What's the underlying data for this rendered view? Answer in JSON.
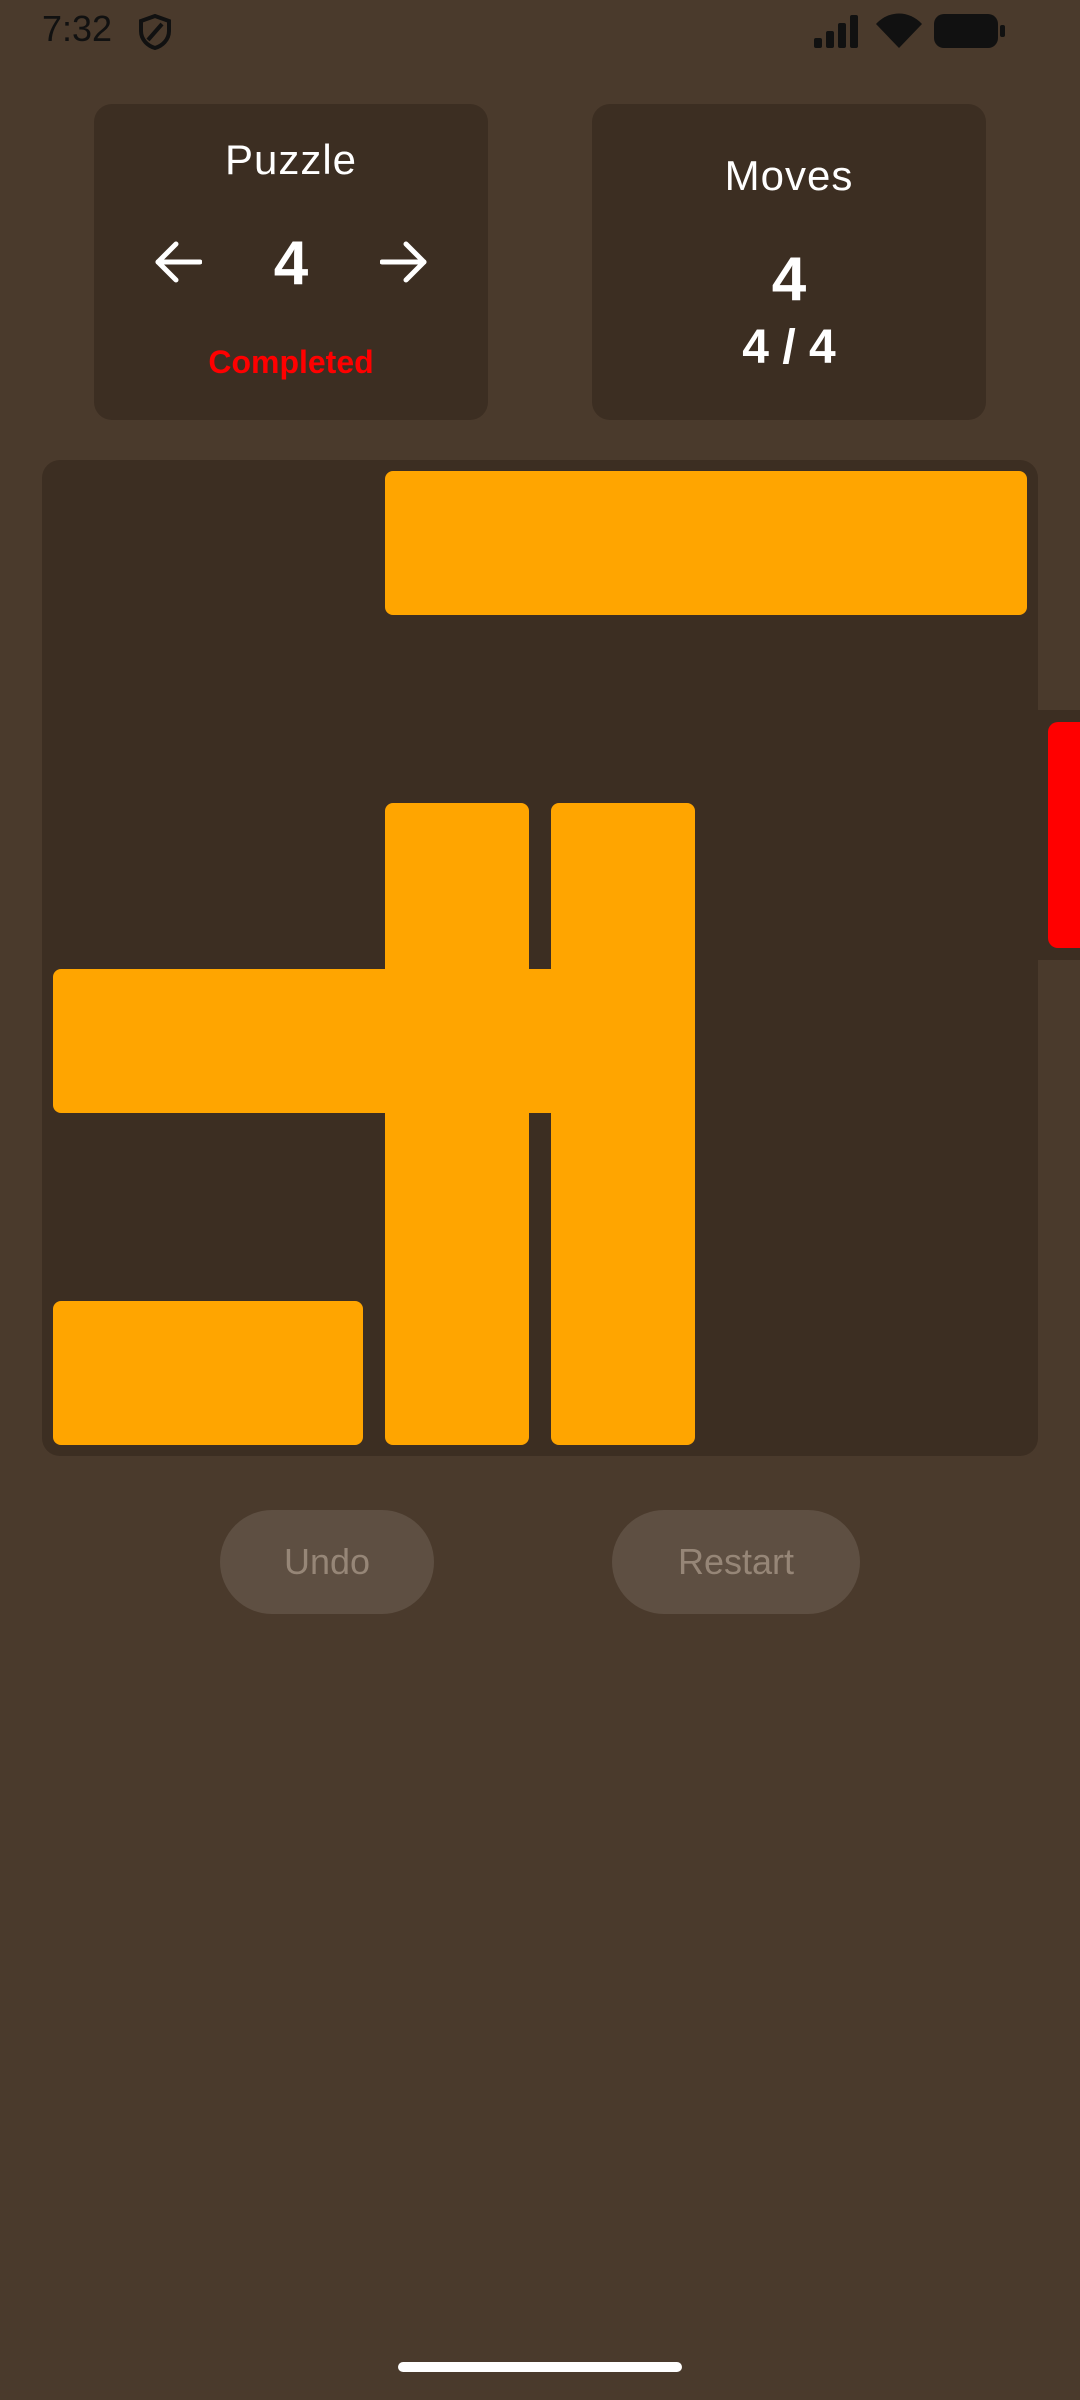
{
  "status_bar": {
    "time": "7:32",
    "icons": [
      "shield-icon",
      "signal-icon",
      "wifi-icon",
      "battery-icon"
    ]
  },
  "puzzle_panel": {
    "title": "Puzzle",
    "number": "4",
    "status": "Completed",
    "prev_icon": "arrow-left-icon",
    "next_icon": "arrow-right-icon"
  },
  "moves_panel": {
    "title": "Moves",
    "count": "4",
    "ratio": "4 / 4"
  },
  "board": {
    "grid_size": 6,
    "exit_row": 2,
    "blocks": [
      {
        "col": 2,
        "row": 0,
        "w": 4,
        "h": 1,
        "orientation": "horizontal"
      },
      {
        "col": 0,
        "row": 3,
        "w": 4,
        "h": 1,
        "orientation": "horizontal"
      },
      {
        "col": 0,
        "row": 5,
        "w": 2,
        "h": 1,
        "orientation": "horizontal"
      },
      {
        "col": 2,
        "row": 2,
        "w": 1,
        "h": 4,
        "orientation": "vertical"
      },
      {
        "col": 3,
        "row": 2,
        "w": 1,
        "h": 4,
        "orientation": "vertical"
      }
    ]
  },
  "actions": {
    "undo_label": "Undo",
    "restart_label": "Restart"
  },
  "colors": {
    "background": "#4a3a2c",
    "panel": "#3c2e22",
    "block": "#ffa500",
    "exit": "#ff0000",
    "completed": "#ff0000",
    "button": "#5e4f42",
    "button_text": "#968677"
  }
}
